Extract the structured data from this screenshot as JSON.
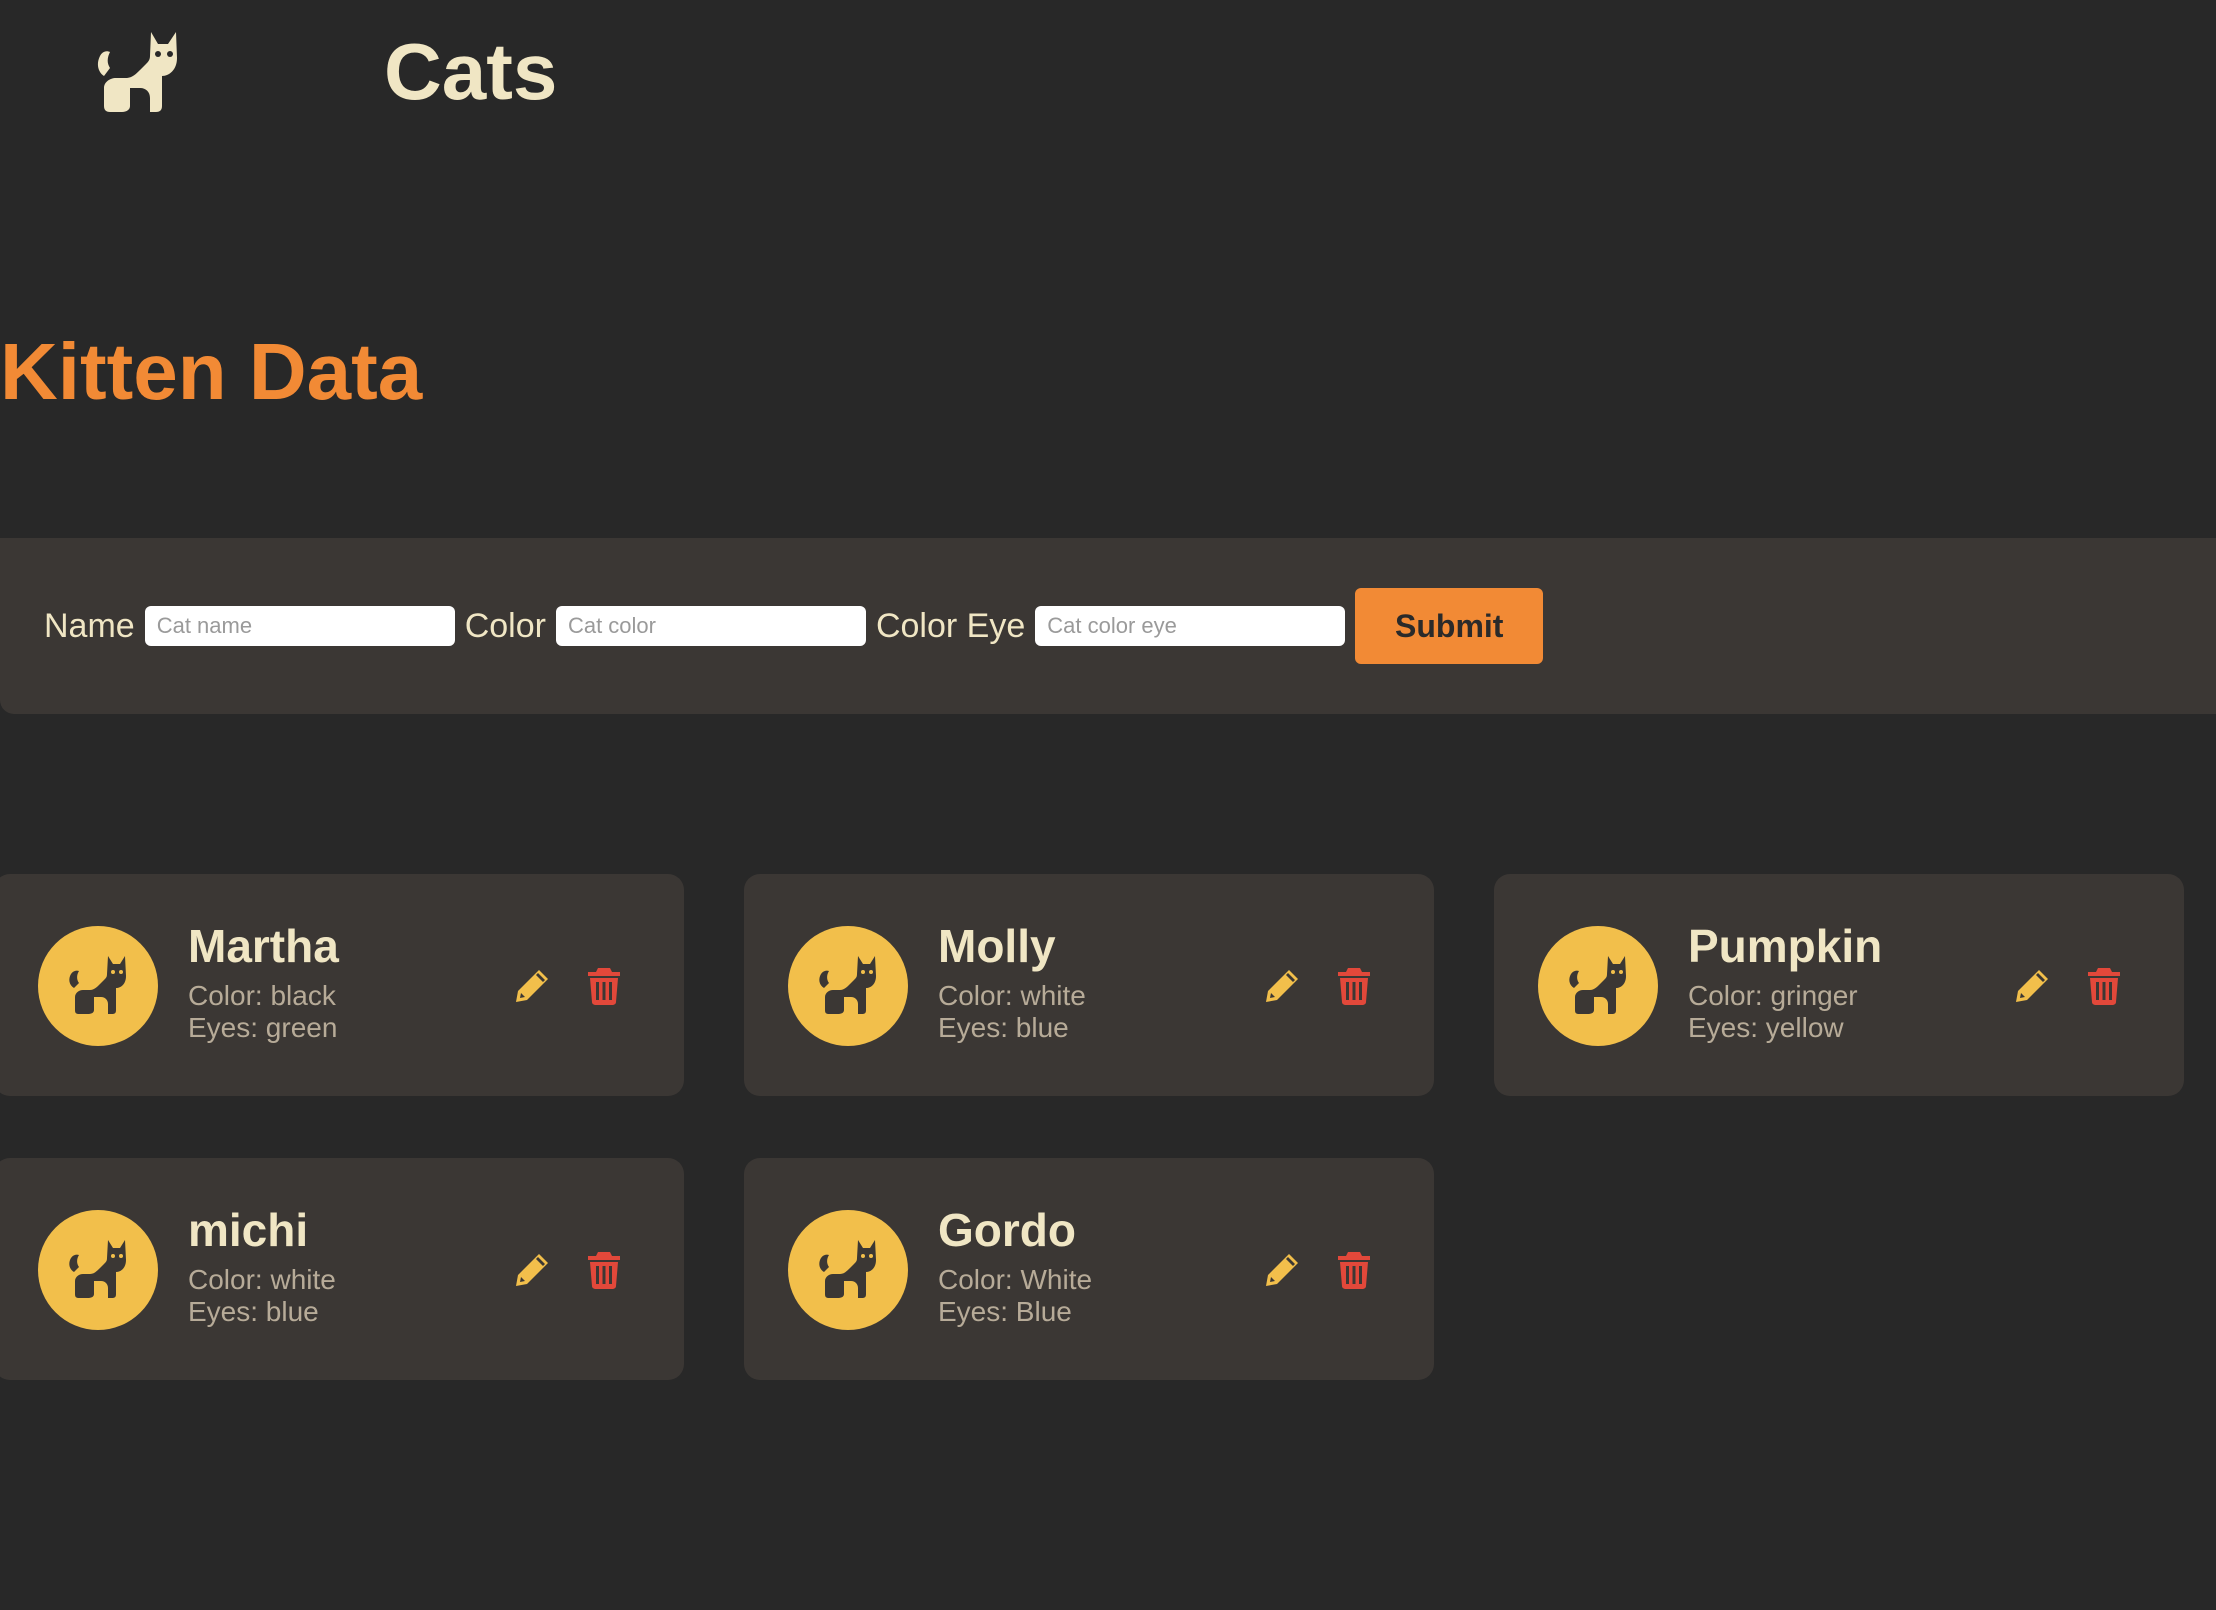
{
  "header": {
    "logo_icon": "cat-icon",
    "title": "Cats"
  },
  "page": {
    "title": "Kitten Data"
  },
  "form": {
    "name_label": "Name",
    "name_placeholder": "Cat name",
    "color_label": "Color",
    "color_placeholder": "Cat color",
    "eye_label": "Color Eye",
    "eye_placeholder": "Cat color eye",
    "submit_label": "Submit"
  },
  "cats": [
    {
      "name": "Martha",
      "color": "Color: black",
      "eyes": "Eyes: green"
    },
    {
      "name": "Molly",
      "color": "Color: white",
      "eyes": "Eyes: blue"
    },
    {
      "name": "Pumpkin",
      "color": "Color: gringer",
      "eyes": "Eyes: yellow"
    },
    {
      "name": "michi",
      "color": "Color: white",
      "eyes": "Eyes: blue"
    },
    {
      "name": "Gordo",
      "color": "Color: White",
      "eyes": "Eyes: Blue"
    }
  ],
  "icons": {
    "avatar": "cat-icon",
    "edit": "pencil-icon",
    "delete": "trash-icon"
  },
  "colors": {
    "background": "#282828",
    "panel": "#3b3734",
    "accent": "#f28a35",
    "avatar": "#f2bf4b",
    "title_text": "#f0e6c4",
    "muted_text": "#b7ab98",
    "edit_icon": "#f2bf4b",
    "delete_icon": "#e2483a"
  }
}
